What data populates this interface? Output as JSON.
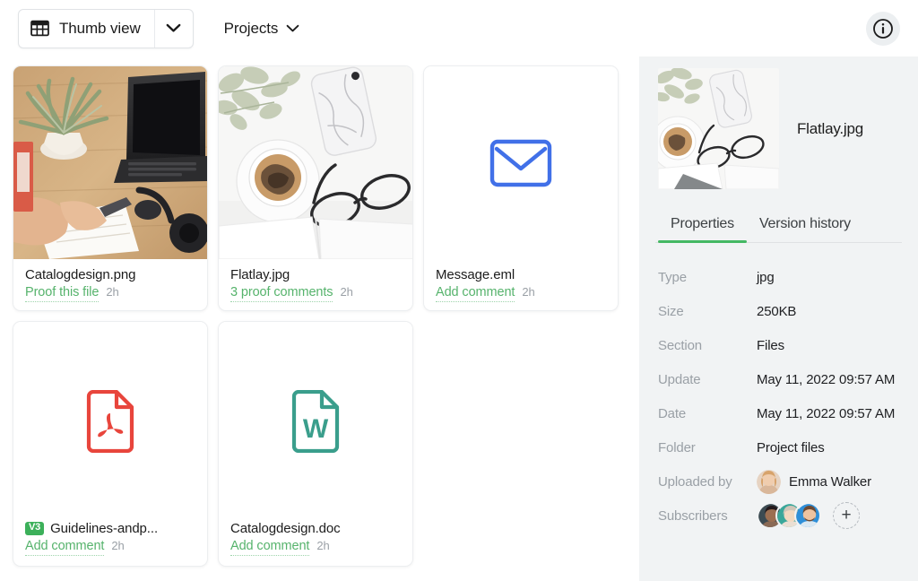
{
  "toolbar": {
    "view_button_label": "Thumb view",
    "view_icon": "grid-icon",
    "view_caret_icon": "chevron-down-icon",
    "projects_label": "Projects",
    "projects_caret_icon": "chevron-down-icon",
    "info_icon": "info-circle-icon"
  },
  "files": [
    {
      "name": "Catalogdesign.png",
      "action": "Proof this file",
      "age": "2h",
      "thumb_type": "photo-desk-laptop",
      "badge": ""
    },
    {
      "name": "Flatlay.jpg",
      "action": "3 proof comments",
      "age": "2h",
      "thumb_type": "photo-flatlay-coffee",
      "badge": ""
    },
    {
      "name": "Message.eml",
      "action": "Add comment",
      "age": "2h",
      "thumb_type": "envelope-icon",
      "badge": ""
    },
    {
      "name": "Guidelines-andp...",
      "action": "Add comment",
      "age": "2h",
      "thumb_type": "pdf-icon",
      "badge": "V3"
    },
    {
      "name": "Catalogdesign.doc",
      "action": "Add comment",
      "age": "2h",
      "thumb_type": "word-icon",
      "badge": ""
    }
  ],
  "sidebar": {
    "file_name": "Flatlay.jpg",
    "thumb_type": "photo-flatlay-coffee",
    "tabs": [
      {
        "label": "Properties",
        "active": true
      },
      {
        "label": "Version history",
        "active": false
      }
    ],
    "properties": [
      {
        "label": "Type",
        "value": "jpg"
      },
      {
        "label": "Size",
        "value": "250KB"
      },
      {
        "label": "Section",
        "value": "Files"
      },
      {
        "label": "Update",
        "value": "May 11, 2022 09:57 AM"
      },
      {
        "label": "Date",
        "value": "May 11, 2022 09:57 AM"
      },
      {
        "label": "Folder",
        "value": "Project files"
      }
    ],
    "uploaded_by": {
      "label": "Uploaded by",
      "name": "Emma Walker"
    },
    "subscribers": {
      "label": "Subscribers",
      "count": 3,
      "add_label": "+"
    }
  },
  "colors": {
    "accent_green": "#44b863",
    "link_green": "#56b36c",
    "badge_green": "#3cb05a",
    "envelope_blue": "#4170e8",
    "pdf_red": "#e8453c",
    "word_teal": "#3a9e8c",
    "sidebar_bg": "#f1f3f4",
    "muted_text": "#9aa0a6"
  }
}
